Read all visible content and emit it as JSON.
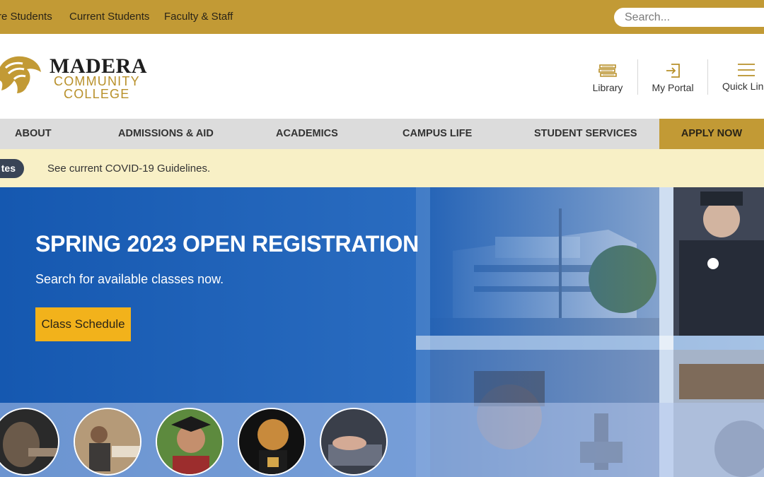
{
  "utility_nav": {
    "links": [
      "re Students",
      "Current Students",
      "Faculty & Staff"
    ],
    "search_placeholder": "Search..."
  },
  "header": {
    "logo_name": "MADERA",
    "logo_line1": "COMMUNITY",
    "logo_line2": "COLLEGE",
    "icons": [
      {
        "label": "Library",
        "icon": "books-icon"
      },
      {
        "label": "My Portal",
        "icon": "login-icon"
      },
      {
        "label": "Quick Link",
        "icon": "hamburger-icon"
      }
    ]
  },
  "main_nav": {
    "items": [
      "ABOUT",
      "ADMISSIONS & AID",
      "ACADEMICS",
      "CAMPUS LIFE",
      "STUDENT SERVICES"
    ],
    "apply": "APPLY NOW"
  },
  "alert": {
    "badge": "tes",
    "text": "See current COVID-19 Guidelines."
  },
  "hero": {
    "title": "SPRING 2023 OPEN REGISTRATION",
    "subtitle": "Search for available classes now.",
    "button": "Class Schedule"
  },
  "colors": {
    "gold": "#c29a35",
    "hero_blue": "#1e5cb3",
    "button_yellow": "#f2b21b",
    "alert_bg": "#f8f0c6",
    "nav_bg": "#dcdcdc"
  }
}
